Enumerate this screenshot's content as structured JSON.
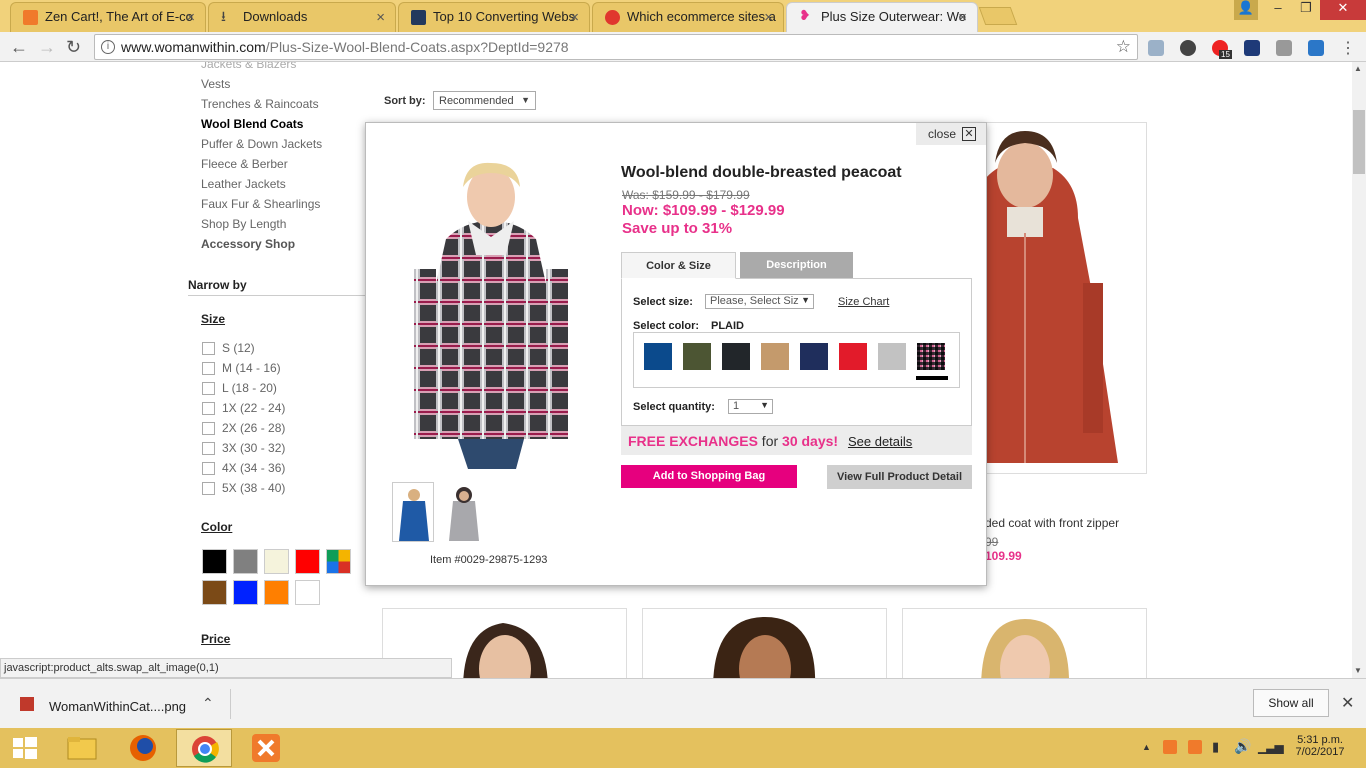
{
  "browser": {
    "tabs": [
      {
        "title": "Zen Cart!, The Art of E-co"
      },
      {
        "title": "Downloads"
      },
      {
        "title": "Top 10 Converting Webs"
      },
      {
        "title": "Which ecommerce sites a"
      },
      {
        "title": "Plus Size Outerwear: Wo"
      }
    ],
    "url_host": "www.womanwithin.com",
    "url_path": "/Plus-Size-Wool-Blend-Coats.aspx?DeptId=9278",
    "ext_badge": "15"
  },
  "sidebar": {
    "truncated_link": "Jackets & Blazers",
    "links": [
      "Vests",
      "Trenches & Raincoats",
      "Wool Blend Coats",
      "Puffer & Down Jackets",
      "Fleece & Berber",
      "Leather Jackets",
      "Faux Fur & Shearlings",
      "Shop By Length",
      "Accessory Shop"
    ],
    "narrow_by": "Narrow by",
    "size_heading": "Size",
    "sizes": [
      "S (12)",
      "M (14 - 16)",
      "L (18 - 20)",
      "1X (22 - 24)",
      "2X (26 - 28)",
      "3X (30 - 32)",
      "4X (34 - 36)",
      "5X (38 - 40)"
    ],
    "color_heading": "Color",
    "colors": [
      "#000000",
      "#808080",
      "#f5f3dc",
      "#ff0000",
      "multi",
      "#7b4a17",
      "#0022ff",
      "#ff7f00",
      "#ffffff"
    ],
    "price_heading": "Price"
  },
  "listing": {
    "sort_label": "Sort by:",
    "sort_value": "Recommended",
    "partial_title": "ded coat with front zipper",
    "partial_was": "99",
    "partial_now": "109.99"
  },
  "quickview": {
    "close_label": "close",
    "title": "Wool-blend double-breasted peacoat",
    "was_price": "Was: $159.99 - $179.99",
    "now_price": "Now: $109.99 - $129.99",
    "save_text": "Save up to 31%",
    "tab_color_size": "Color & Size",
    "tab_description": "Description",
    "select_size_label": "Select size:",
    "size_placeholder": "Please, Select Siz",
    "size_chart": "Size Chart",
    "select_color_label": "Select color:",
    "selected_color": "PLAID",
    "swatches": [
      "#0b4a8c",
      "#4c5533",
      "#22262a",
      "#c49a6c",
      "#1f2e5c",
      "#e21b2a",
      "#c2c2c2",
      "plaid"
    ],
    "select_qty_label": "Select quantity:",
    "qty_value": "1",
    "free_exch_1": "FREE EXCHANGES",
    "free_exch_2": " for ",
    "free_exch_3": "30 days!",
    "see_details": "See details",
    "add_to_bag": "Add to Shopping Bag",
    "view_full": "View Full Product Detail",
    "item_number": "Item #0029-29875-1293"
  },
  "status_url": "javascript:product_alts.swap_alt_image(0,1)",
  "download": {
    "filename": "WomanWithinCat....png",
    "show_all": "Show all"
  },
  "clock": {
    "time": "5:31 p.m.",
    "date": "7/02/2017"
  }
}
